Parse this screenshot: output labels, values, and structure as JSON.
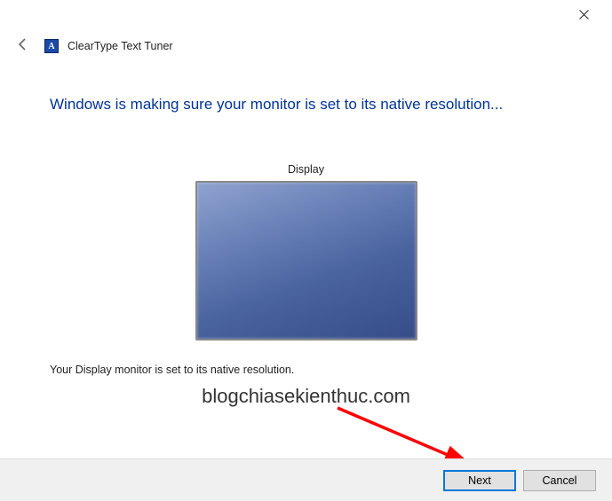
{
  "window": {
    "title": "ClearType Text Tuner"
  },
  "main": {
    "heading": "Windows is making sure your monitor is set to its native resolution...",
    "display_label": "Display",
    "status_text": "Your Display monitor is set to its native resolution."
  },
  "footer": {
    "next_label": "Next",
    "cancel_label": "Cancel"
  },
  "overlay": {
    "watermark": "blogchiasekienthuc.com"
  }
}
